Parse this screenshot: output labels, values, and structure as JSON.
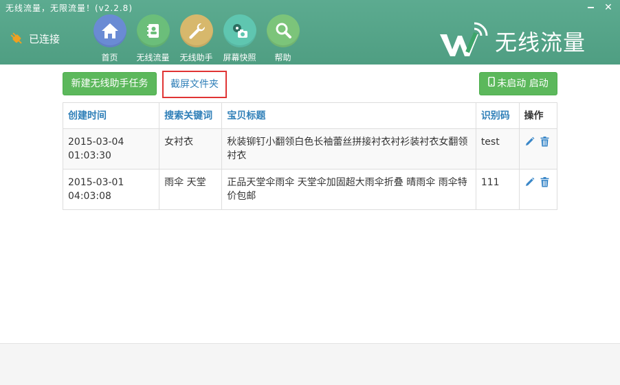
{
  "window": {
    "title": "无线流量，无限流量！(v2.2.8)",
    "min_label": "",
    "close_label": "✕"
  },
  "status": {
    "label": "已连接"
  },
  "nav": [
    {
      "label": "首页",
      "icon": "home-icon",
      "color": "#6a8bd4"
    },
    {
      "label": "无线流量",
      "icon": "contacts-icon",
      "color": "#6bbe7a"
    },
    {
      "label": "无线助手",
      "icon": "wrench-icon",
      "color": "#d7b86c"
    },
    {
      "label": "屏幕快照",
      "icon": "camera-icon",
      "color": "#5fc6b0"
    },
    {
      "label": "帮助",
      "icon": "magnifier-icon",
      "color": "#7cc47a"
    }
  ],
  "brand": {
    "name": "无线流量"
  },
  "toolbar": {
    "new_task_label": "新建无线助手任务",
    "folder_label": "截屏文件夹",
    "start_label": "未启动 启动"
  },
  "table": {
    "headers": [
      "创建时间",
      "搜索关键词",
      "宝贝标题",
      "识别码",
      "操作"
    ],
    "rows": [
      {
        "date": "2015-03-04",
        "time": "01:03:30",
        "keyword": "女衬衣",
        "title": "秋装铆钉小翻领白色长袖蕾丝拼接衬衣衬衫装衬衣女翻领衬衣",
        "code": "test"
      },
      {
        "date": "2015-03-01",
        "time": "04:03:08",
        "keyword": "雨伞 天堂",
        "title": "正品天堂伞雨伞 天堂伞加固超大雨伞折叠 晴雨伞 雨伞特价包邮",
        "code": "111"
      }
    ]
  },
  "colors": {
    "header": "#55a487",
    "accent_blue": "#2f7fb8",
    "button_green": "#5cb85c",
    "highlight_red": "#e03333"
  }
}
